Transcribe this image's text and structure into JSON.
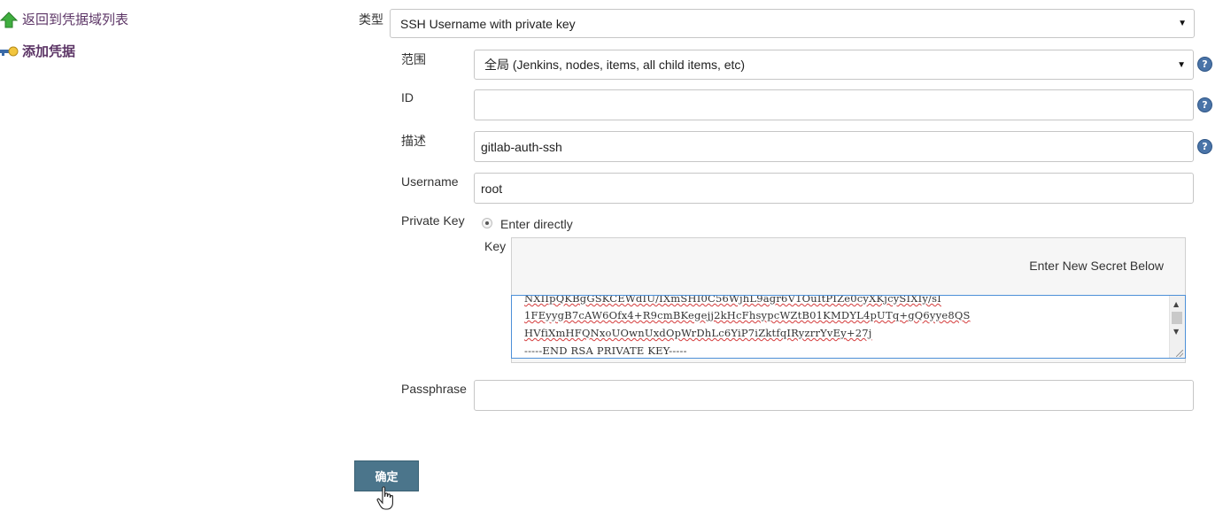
{
  "sidebar": {
    "back_label": "返回到凭据域列表",
    "add_label": "添加凭据",
    "back_icon": "up-arrow-icon",
    "add_icon": "key-icon"
  },
  "form": {
    "kind_label": "类型",
    "kind_value": "SSH Username with private key",
    "scope_label": "范围",
    "scope_value": "全局 (Jenkins, nodes, items, all child items, etc)",
    "id_label": "ID",
    "id_value": "",
    "description_label": "描述",
    "description_value": "gitlab-auth-ssh",
    "username_label": "Username",
    "username_value": "root",
    "private_key_label": "Private Key",
    "enter_directly_label": "Enter directly",
    "key_label": "Key",
    "secret_notice": "Enter New Secret Below",
    "key_lines": [
      "NXIIpQKBgGSKCEWdIU/IXmSHI0C56WjhL9agr6V1OuItPIZe0cyXKjcySIXIy/sI",
      "1FEyygB7cAW6Ofx4+R9cmBKegejj2kHcFhsypcWZtB01KMDYL4pUTq+gQ6yye8QS",
      "HVfiXmHFQNxoUOwnUxdOpWrDhLc6YiP7iZktfqIRyzrrYvEy+27j",
      "-----END RSA PRIVATE KEY-----"
    ],
    "passphrase_label": "Passphrase",
    "passphrase_value": "",
    "help_glyph": "?",
    "submit_label": "确定"
  }
}
